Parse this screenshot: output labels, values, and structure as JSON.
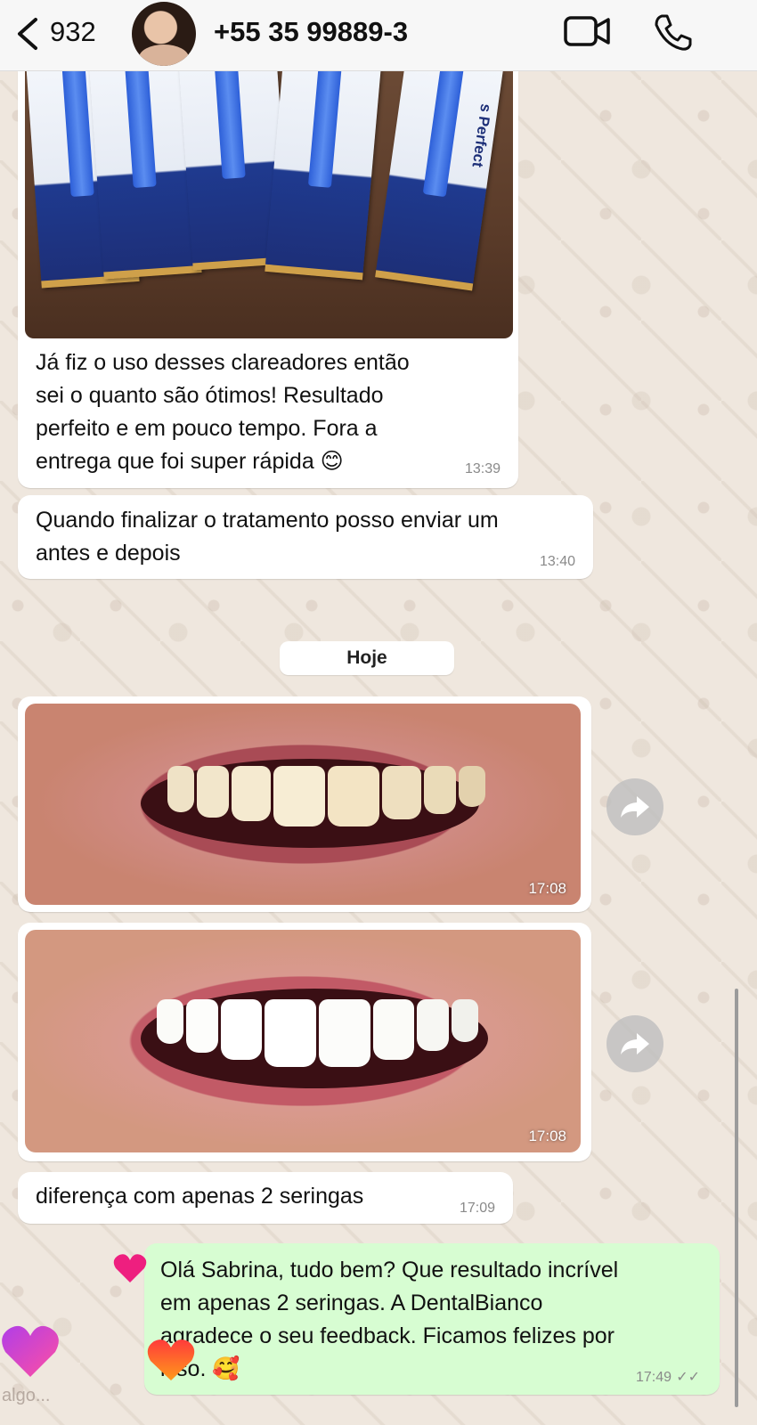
{
  "header": {
    "back_count": "932",
    "contact_name": "+55 35 99889-3",
    "icons": {
      "back": "chevron-left-icon",
      "video": "video-call-icon",
      "call": "phone-icon"
    }
  },
  "messages": {
    "product_caption": {
      "text_lines": [
        "Já fiz o uso desses clareadores então",
        "sei o quanto são ótimos! Resultado",
        "perfeito e em pouco tempo. Fora a",
        "entrega que foi super rápida 😊"
      ],
      "time": "13:39",
      "pack_brand": "s Perfect"
    },
    "treatment": {
      "text_lines": [
        "Quando finalizar o tratamento posso enviar um",
        "antes e depois"
      ],
      "time": "13:40"
    },
    "date_separator": "Hoje",
    "photo_before": {
      "time": "17:08"
    },
    "photo_after": {
      "time": "17:08"
    },
    "difference": {
      "text": "diferença com apenas 2 seringas",
      "time": "17:09"
    },
    "reply": {
      "text_lines": [
        "Olá Sabrina, tudo bem? Que resultado incrível",
        "em apenas 2 seringas. A DentalBianco",
        "agradece o seu feedback. Ficamos felizes por",
        "isso. 🥰"
      ],
      "time": "17:49",
      "status": "✓✓"
    }
  },
  "overlay": {
    "bottom_text": "algo...",
    "hearts": [
      "pink-heart-icon",
      "purple-heart-icon",
      "orange-heart-icon"
    ]
  },
  "colors": {
    "wallpaper": "#efe7de",
    "incoming_bubble": "#ffffff",
    "outgoing_bubble": "#d7fdd2",
    "timestamp": "#8a8a8a"
  }
}
